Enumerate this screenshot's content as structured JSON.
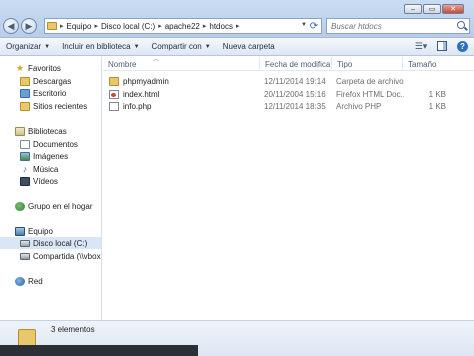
{
  "window": {
    "controls": {
      "minimize": "–",
      "maximize": "▭",
      "close": "✕"
    }
  },
  "address": {
    "segments": [
      "Equipo",
      "Disco local (C:)",
      "apache22",
      "htdocs"
    ],
    "separator": "▸"
  },
  "search": {
    "placeholder": "Buscar htdocs"
  },
  "commandbar": {
    "organize": "Organizar",
    "include_library": "Incluir en biblioteca",
    "share_with": "Compartir con",
    "new_folder": "Nueva carpeta"
  },
  "navpane": {
    "favorites": {
      "label": "Favoritos",
      "items": [
        "Descargas",
        "Escritorio",
        "Sitios recientes"
      ]
    },
    "libraries": {
      "label": "Bibliotecas",
      "items": [
        "Documentos",
        "Imágenes",
        "Música",
        "Vídeos"
      ]
    },
    "homegroup": "Grupo en el hogar",
    "computer": {
      "label": "Equipo",
      "items": [
        "Disco local (C:)",
        "Compartida (\\\\vbox"
      ]
    },
    "network": "Red"
  },
  "filelist": {
    "columns": {
      "name": "Nombre",
      "date": "Fecha de modifica...",
      "type": "Tipo",
      "size": "Tamaño"
    },
    "rows": [
      {
        "name": "phpmyadmin",
        "date": "12/11/2014 19:14",
        "type": "Carpeta de archivos",
        "size": "",
        "icon": "folder"
      },
      {
        "name": "index.html",
        "date": "20/11/2004 15:16",
        "type": "Firefox HTML Doc...",
        "size": "1 KB",
        "icon": "html"
      },
      {
        "name": "info.php",
        "date": "12/11/2014 18:35",
        "type": "Archivo PHP",
        "size": "1 KB",
        "icon": "php"
      }
    ]
  },
  "status": {
    "count": "3 elementos"
  },
  "colors": {
    "chrome": "#c9dcf2",
    "selection": "#d9e6f5",
    "folder": "#e8c86a"
  }
}
